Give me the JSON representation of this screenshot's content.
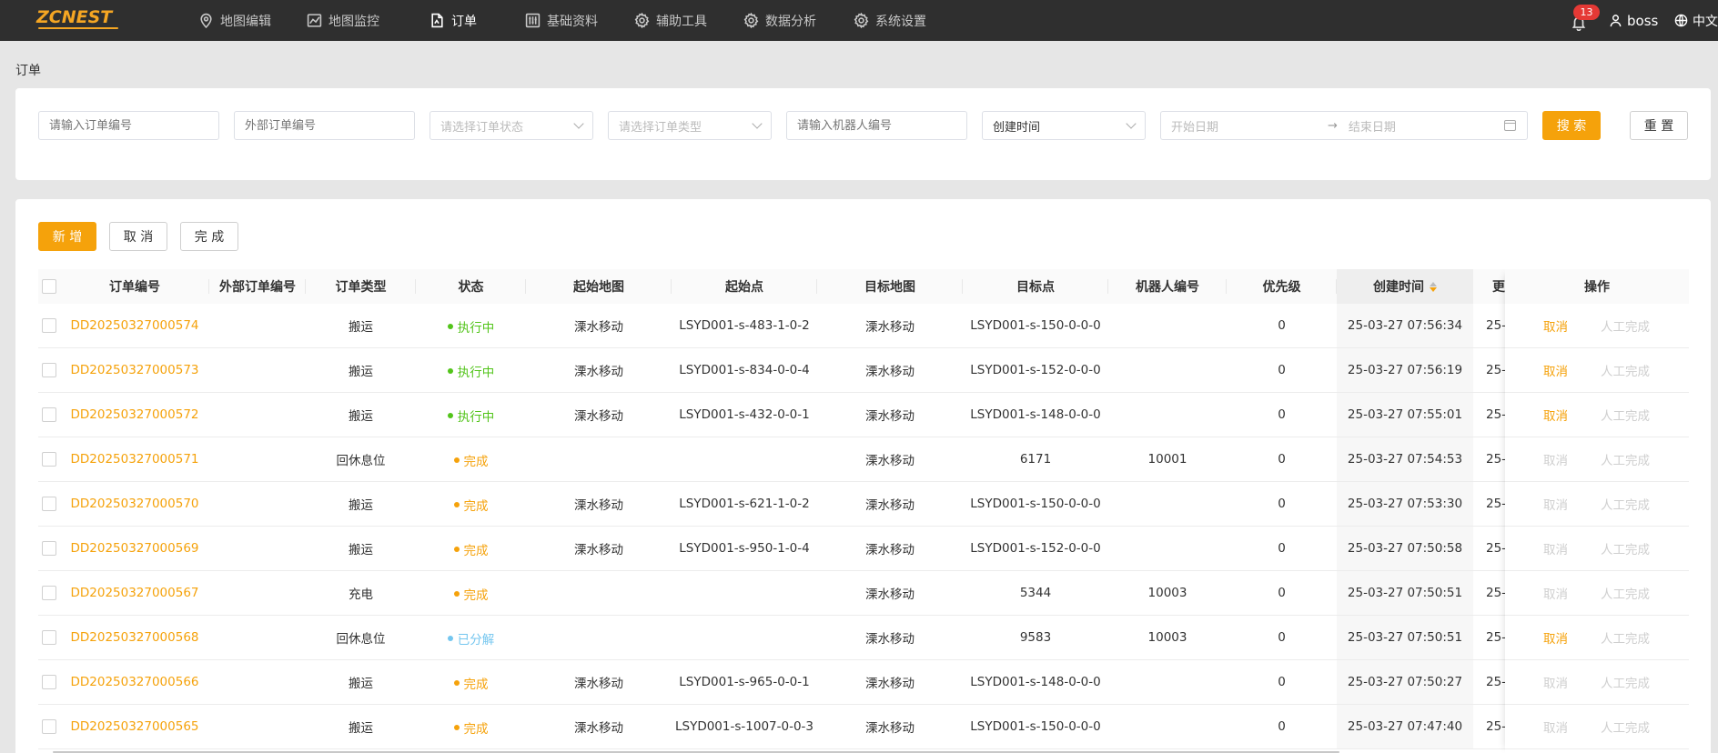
{
  "app": {
    "logo": "ZCNEST",
    "nav": [
      {
        "label": "地图编辑",
        "icon": "map-pin-icon"
      },
      {
        "label": "地图监控",
        "icon": "chart-icon"
      },
      {
        "label": "订单",
        "icon": "document-icon"
      },
      {
        "label": "基础资料",
        "icon": "sliders-icon"
      },
      {
        "label": "辅助工具",
        "icon": "gear-icon"
      },
      {
        "label": "数据分析",
        "icon": "gear-icon"
      },
      {
        "label": "系统设置",
        "icon": "gear-icon"
      }
    ],
    "active_nav": "订单",
    "notification_count": "13",
    "username": "boss",
    "language": "中文"
  },
  "breadcrumb": "订单",
  "filters": {
    "order_no_placeholder": "请输入订单编号",
    "external_no_placeholder": "外部订单编号",
    "status_placeholder": "请选择订单状态",
    "type_placeholder": "请选择订单类型",
    "robot_placeholder": "请输入机器人编号",
    "time_field": "创建时间",
    "start_date_placeholder": "开始日期",
    "range_separator": "→",
    "end_date_placeholder": "结束日期",
    "search_label": "搜 索",
    "reset_label": "重 置"
  },
  "toolbar": {
    "add_label": "新 增",
    "cancel_label": "取 消",
    "complete_label": "完 成"
  },
  "table": {
    "columns": [
      "订单编号",
      "外部订单编号",
      "订单类型",
      "状态",
      "起始地图",
      "起始点",
      "目标地图",
      "目标点",
      "机器人编号",
      "优先级",
      "创建时间",
      "操作"
    ],
    "truncated_col_label": "更",
    "truncated_cell": "25-",
    "op_cancel": "取消",
    "op_manual": "人工完成",
    "rows": [
      {
        "id": "DD20250327000574",
        "ext": "",
        "type": "搬运",
        "status": "执行中",
        "status_color": "#52c41a",
        "from_map": "溧水移动",
        "from_pt": "LSYD001-s-483-1-0-2",
        "to_map": "溧水移动",
        "to_pt": "LSYD001-s-150-0-0-0",
        "robot": "",
        "priority": "0",
        "created": "25-03-27 07:56:34",
        "cancel_enabled": true
      },
      {
        "id": "DD20250327000573",
        "ext": "",
        "type": "搬运",
        "status": "执行中",
        "status_color": "#52c41a",
        "from_map": "溧水移动",
        "from_pt": "LSYD001-s-834-0-0-4",
        "to_map": "溧水移动",
        "to_pt": "LSYD001-s-152-0-0-0",
        "robot": "",
        "priority": "0",
        "created": "25-03-27 07:56:19",
        "cancel_enabled": true
      },
      {
        "id": "DD20250327000572",
        "ext": "",
        "type": "搬运",
        "status": "执行中",
        "status_color": "#52c41a",
        "from_map": "溧水移动",
        "from_pt": "LSYD001-s-432-0-0-1",
        "to_map": "溧水移动",
        "to_pt": "LSYD001-s-148-0-0-0",
        "robot": "",
        "priority": "0",
        "created": "25-03-27 07:55:01",
        "cancel_enabled": true
      },
      {
        "id": "DD20250327000571",
        "ext": "",
        "type": "回休息位",
        "status": "完成",
        "status_color": "#f5a20b",
        "from_map": "",
        "from_pt": "",
        "to_map": "溧水移动",
        "to_pt": "6171",
        "robot": "10001",
        "priority": "0",
        "created": "25-03-27 07:54:53",
        "cancel_enabled": false
      },
      {
        "id": "DD20250327000570",
        "ext": "",
        "type": "搬运",
        "status": "完成",
        "status_color": "#f5a20b",
        "from_map": "溧水移动",
        "from_pt": "LSYD001-s-621-1-0-2",
        "to_map": "溧水移动",
        "to_pt": "LSYD001-s-150-0-0-0",
        "robot": "",
        "priority": "0",
        "created": "25-03-27 07:53:30",
        "cancel_enabled": false
      },
      {
        "id": "DD20250327000569",
        "ext": "",
        "type": "搬运",
        "status": "完成",
        "status_color": "#f5a20b",
        "from_map": "溧水移动",
        "from_pt": "LSYD001-s-950-1-0-4",
        "to_map": "溧水移动",
        "to_pt": "LSYD001-s-152-0-0-0",
        "robot": "",
        "priority": "0",
        "created": "25-03-27 07:50:58",
        "cancel_enabled": false
      },
      {
        "id": "DD20250327000567",
        "ext": "",
        "type": "充电",
        "status": "完成",
        "status_color": "#f5a20b",
        "from_map": "",
        "from_pt": "",
        "to_map": "溧水移动",
        "to_pt": "5344",
        "robot": "10003",
        "priority": "0",
        "created": "25-03-27 07:50:51",
        "cancel_enabled": false
      },
      {
        "id": "DD20250327000568",
        "ext": "",
        "type": "回休息位",
        "status": "已分解",
        "status_color": "#74c6ef",
        "from_map": "",
        "from_pt": "",
        "to_map": "溧水移动",
        "to_pt": "9583",
        "robot": "10003",
        "priority": "0",
        "created": "25-03-27 07:50:51",
        "cancel_enabled": true
      },
      {
        "id": "DD20250327000566",
        "ext": "",
        "type": "搬运",
        "status": "完成",
        "status_color": "#f5a20b",
        "from_map": "溧水移动",
        "from_pt": "LSYD001-s-965-0-0-1",
        "to_map": "溧水移动",
        "to_pt": "LSYD001-s-148-0-0-0",
        "robot": "",
        "priority": "0",
        "created": "25-03-27 07:50:27",
        "cancel_enabled": false
      },
      {
        "id": "DD20250327000565",
        "ext": "",
        "type": "搬运",
        "status": "完成",
        "status_color": "#f5a20b",
        "from_map": "溧水移动",
        "from_pt": "LSYD001-s-1007-0-0-3",
        "to_map": "溧水移动",
        "to_pt": "LSYD001-s-150-0-0-0",
        "robot": "",
        "priority": "0",
        "created": "25-03-27 07:47:40",
        "cancel_enabled": false
      }
    ]
  },
  "colors": {
    "brand": "#f5a20b",
    "topbar": "#2f2f2f",
    "running": "#52c41a",
    "done": "#f5a20b",
    "split": "#74c6ef"
  }
}
